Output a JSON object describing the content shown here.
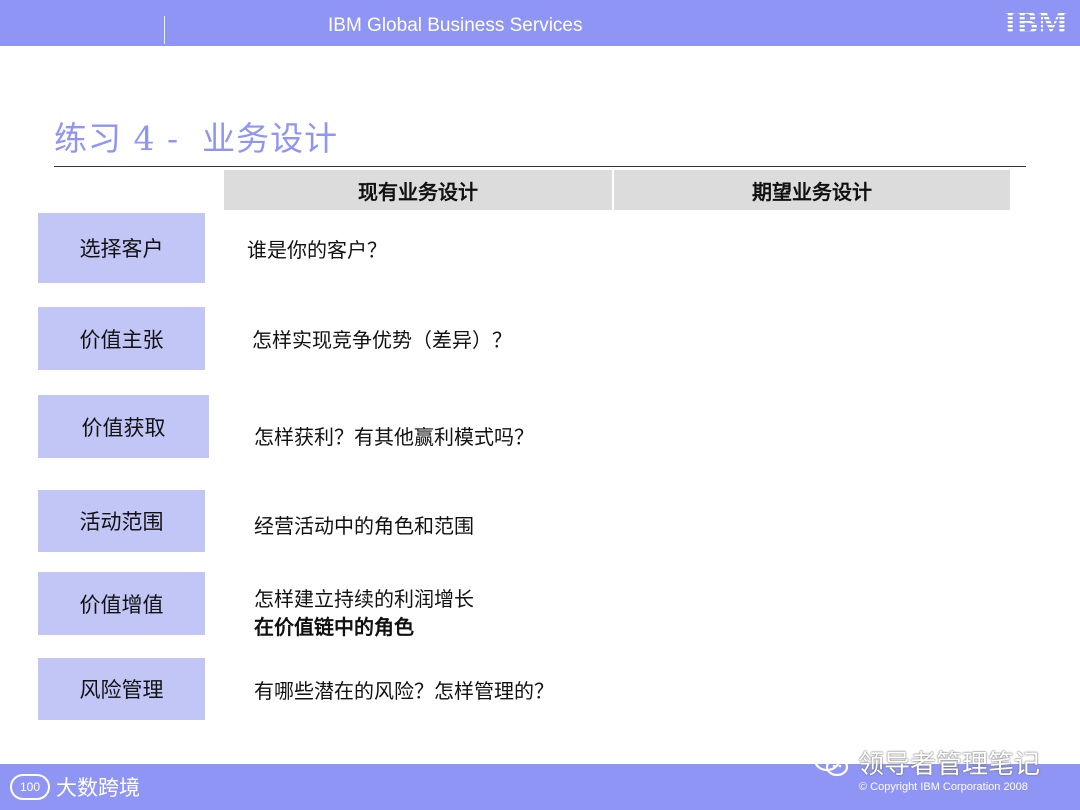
{
  "header": {
    "title": "IBM Global Business Services",
    "logo": "IBM"
  },
  "slide": {
    "title": "练习 4 -  业务设计",
    "columns": [
      "现有业务设计",
      "期望业务设计"
    ],
    "rows": [
      {
        "label": "选择客户",
        "text": "谁是你的客户？"
      },
      {
        "label": "价值主张",
        "text": "怎样实现竞争优势（差异）？"
      },
      {
        "label": "价值获取",
        "text": "怎样获利？有其他赢利模式吗？"
      },
      {
        "label": "活动范围",
        "text": "经营活动中的角色和范围"
      },
      {
        "label": "价值增值",
        "text": "怎样建立持续的利润增长",
        "text2": "在价值链中的角色"
      },
      {
        "label": "风险管理",
        "text": "有哪些潜在的风险？怎样管理的？"
      }
    ]
  },
  "footer": {
    "copyright": "© Copyright IBM Corporation 2008",
    "watermark_left": "大数跨境",
    "watermark_left_badge": "100",
    "watermark_right": "领导者管理笔记"
  },
  "colors": {
    "accent": "#8f95f5",
    "label_bg": "#c1c6f7",
    "column_header_bg": "#dcdcdc"
  }
}
